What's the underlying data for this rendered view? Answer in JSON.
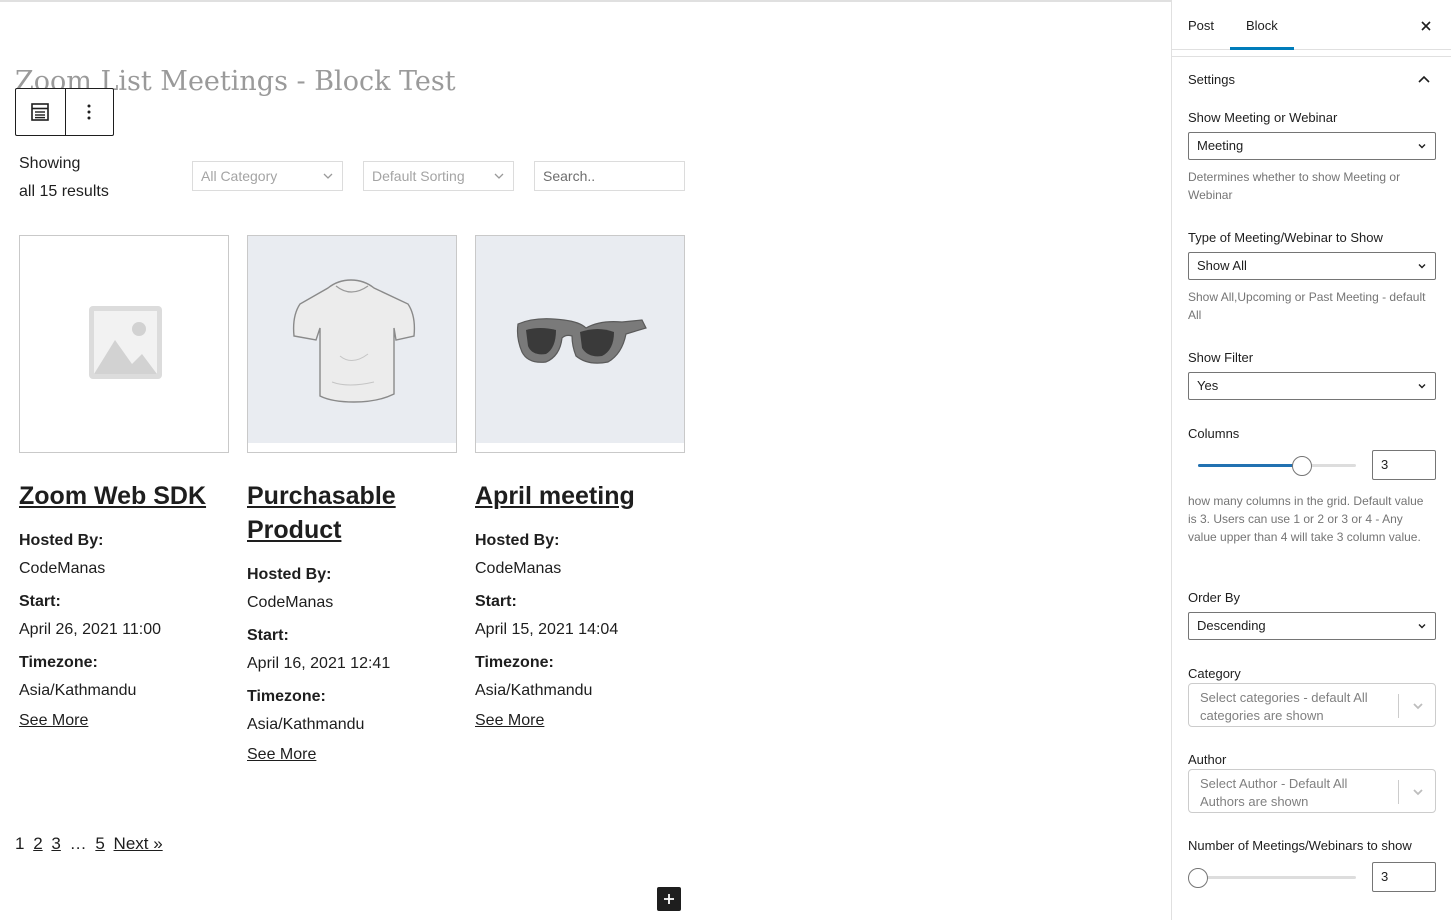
{
  "editor": {
    "post_title": "Zoom List Meetings - Block Test",
    "toolbar": {
      "list_icon": "list-view-icon",
      "more_icon": "more-vertical-icon"
    }
  },
  "results": {
    "showing_line1": "Showing",
    "showing_line2": "all 15 results"
  },
  "filters": {
    "category_placeholder": "All Category",
    "sorting_placeholder": "Default Sorting",
    "search_placeholder": "Search.."
  },
  "meetings": [
    {
      "title": "Zoom Web SDK",
      "hosted_label": "Hosted By:",
      "host": "CodeManas",
      "start_label": "Start:",
      "start": "April 26, 2021 11:00",
      "timezone_label": "Timezone:",
      "timezone": "Asia/Kathmandu",
      "link": "See More",
      "image": "placeholder-image-icon"
    },
    {
      "title": "Purchasable Product",
      "hosted_label": "Hosted By:",
      "host": "CodeManas",
      "start_label": "Start:",
      "start": "April 16, 2021 12:41",
      "timezone_label": "Timezone:",
      "timezone": "Asia/Kathmandu",
      "link": "See More",
      "image": "t-shirt-image"
    },
    {
      "title": "April meeting",
      "hosted_label": "Hosted By:",
      "host": "CodeManas",
      "start_label": "Start:",
      "start": "April 15, 2021 14:04",
      "timezone_label": "Timezone:",
      "timezone": "Asia/Kathmandu",
      "link": "See More",
      "image": "sunglasses-image"
    }
  ],
  "pagination": {
    "p1": "1",
    "p2": "2",
    "p3": "3",
    "ellipsis": "…",
    "p5": "5",
    "next": "Next »"
  },
  "sidebar": {
    "tab_post": "Post",
    "tab_block": "Block",
    "panel_title": "Settings",
    "show_type": {
      "label": "Show Meeting or Webinar",
      "value": "Meeting",
      "help": "Determines whether to show Meeting or Webinar"
    },
    "meeting_type": {
      "label": "Type of Meeting/Webinar to Show",
      "value": "Show All",
      "help": "Show All,Upcoming or Past Meeting - default All"
    },
    "show_filter": {
      "label": "Show Filter",
      "value": "Yes"
    },
    "columns": {
      "label": "Columns",
      "value": "3",
      "fraction": 0.66,
      "help": "how many columns in the grid. Default value is 3. Users can use 1 or 2 or 3 or 4 - Any value upper than 4 will take 3 column value."
    },
    "order_by": {
      "label": "Order By",
      "value": "Descending"
    },
    "category": {
      "label": "Category",
      "placeholder": "Select categories - default All categories are shown"
    },
    "author": {
      "label": "Author",
      "placeholder": "Select Author - Default All Authors are shown"
    },
    "count": {
      "label": "Number of Meetings/Webinars to show",
      "value": "3",
      "fraction": 0.0
    }
  },
  "colors": {
    "accent": "#007cba",
    "slider_fill": "#2271b1",
    "text": "#1e1e1e",
    "muted": "#757575"
  }
}
